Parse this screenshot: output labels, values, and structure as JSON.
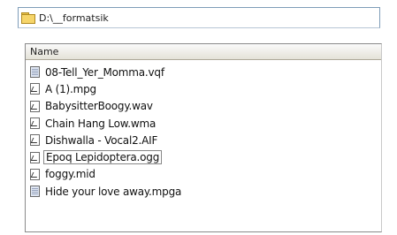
{
  "address_bar": {
    "path": "D:\\__formatsik",
    "icon": "folder-icon"
  },
  "list": {
    "column_header": "Name",
    "files": [
      {
        "name": "08-Tell_Yer_Momma.vqf",
        "icon": "video-file-icon"
      },
      {
        "name": "A (1).mpg",
        "icon": "audio-file-icon"
      },
      {
        "name": "BabysitterBoogy.wav",
        "icon": "audio-file-icon"
      },
      {
        "name": "Chain Hang Low.wma",
        "icon": "audio-file-icon"
      },
      {
        "name": "Dishwalla - Vocal2.AIF",
        "icon": "audio-file-icon"
      },
      {
        "name": "Epoq Lepidoptera.ogg",
        "icon": "audio-file-icon",
        "focused": true
      },
      {
        "name": "foggy.mid",
        "icon": "audio-file-icon"
      },
      {
        "name": "Hide your love away.mpga",
        "icon": "video-file-icon"
      }
    ]
  }
}
